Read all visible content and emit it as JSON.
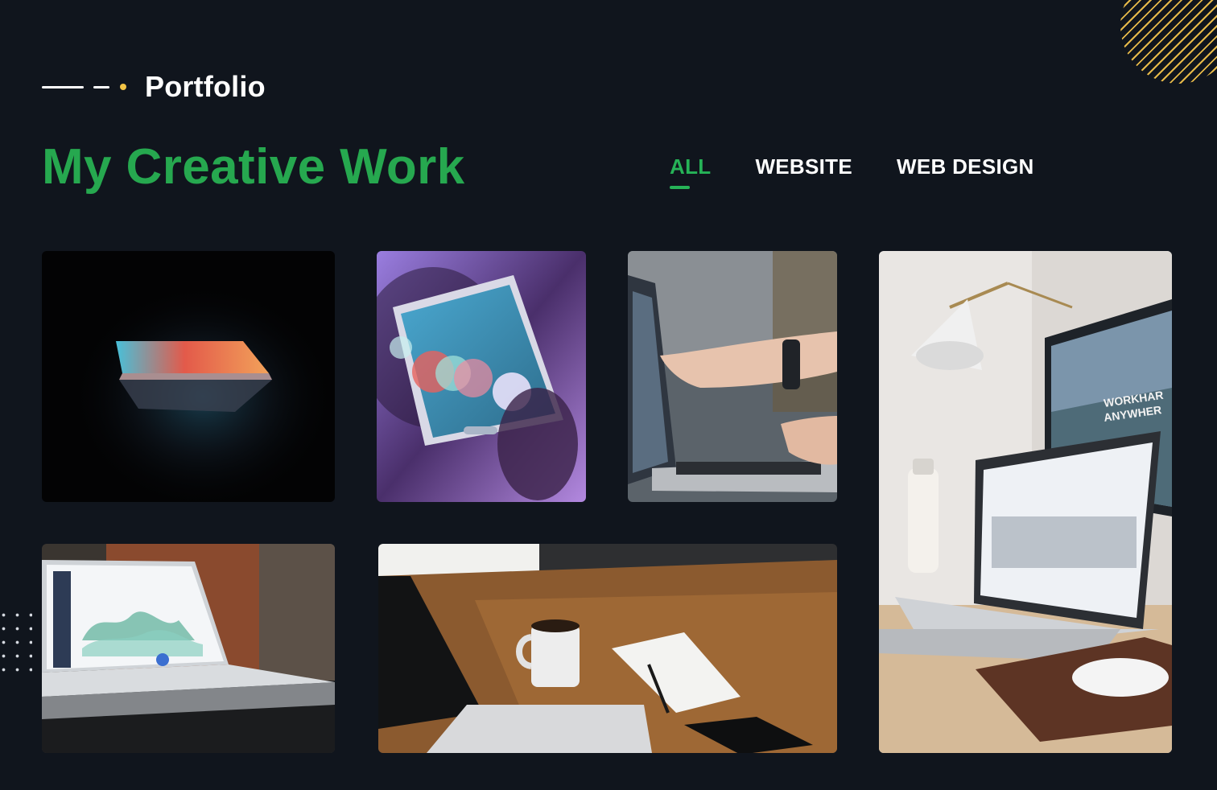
{
  "section": {
    "label": "Portfolio"
  },
  "heading": "My Creative Work",
  "filters": {
    "tabs": [
      {
        "label": "ALL",
        "active": true
      },
      {
        "label": "WEBSITE",
        "active": false
      },
      {
        "label": "WEB DESIGN",
        "active": false
      }
    ]
  },
  "portfolio": {
    "items": [
      {
        "icon": "laptop-dark-photo"
      },
      {
        "icon": "phone-bokeh-photo"
      },
      {
        "icon": "pointing-laptop-photo"
      },
      {
        "icon": "desk-setup-photo",
        "screen_text": [
          "WORKHAR",
          "ANYWHER"
        ]
      },
      {
        "icon": "analytics-laptop-photo"
      },
      {
        "icon": "coffee-desk-photo"
      }
    ]
  },
  "colors": {
    "background": "#10151d",
    "accent": "#26a84f",
    "active_tab": "#26b357",
    "dot": "#f2c446",
    "stripes": "#e6b949"
  }
}
